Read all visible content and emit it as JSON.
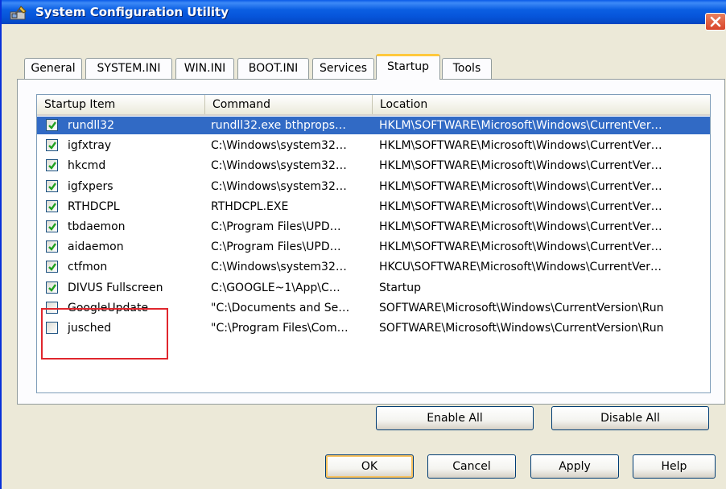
{
  "window": {
    "title": "System Configuration Utility",
    "accent": "#0654d9",
    "close_color": "#d9442a"
  },
  "tabs": [
    {
      "label": "General",
      "active": false
    },
    {
      "label": "SYSTEM.INI",
      "active": false
    },
    {
      "label": "WIN.INI",
      "active": false
    },
    {
      "label": "BOOT.INI",
      "active": false
    },
    {
      "label": "Services",
      "active": false
    },
    {
      "label": "Startup",
      "active": true
    },
    {
      "label": "Tools",
      "active": false
    }
  ],
  "list": {
    "columns": [
      "Startup Item",
      "Command",
      "Location"
    ],
    "rows": [
      {
        "checked": true,
        "selected": true,
        "item": "rundll32",
        "command": "rundll32.exe bthprops…",
        "location": "HKLM\\SOFTWARE\\Microsoft\\Windows\\CurrentVer…"
      },
      {
        "checked": true,
        "selected": false,
        "item": "igfxtray",
        "command": "C:\\Windows\\system32…",
        "location": "HKLM\\SOFTWARE\\Microsoft\\Windows\\CurrentVer…"
      },
      {
        "checked": true,
        "selected": false,
        "item": "hkcmd",
        "command": "C:\\Windows\\system32…",
        "location": "HKLM\\SOFTWARE\\Microsoft\\Windows\\CurrentVer…"
      },
      {
        "checked": true,
        "selected": false,
        "item": "igfxpers",
        "command": "C:\\Windows\\system32…",
        "location": "HKLM\\SOFTWARE\\Microsoft\\Windows\\CurrentVer…"
      },
      {
        "checked": true,
        "selected": false,
        "item": "RTHDCPL",
        "command": "RTHDCPL.EXE",
        "location": "HKLM\\SOFTWARE\\Microsoft\\Windows\\CurrentVer…"
      },
      {
        "checked": true,
        "selected": false,
        "item": "tbdaemon",
        "command": "C:\\Program Files\\UPD…",
        "location": "HKLM\\SOFTWARE\\Microsoft\\Windows\\CurrentVer…"
      },
      {
        "checked": true,
        "selected": false,
        "item": "aidaemon",
        "command": "C:\\Program Files\\UPD…",
        "location": "HKLM\\SOFTWARE\\Microsoft\\Windows\\CurrentVer…"
      },
      {
        "checked": true,
        "selected": false,
        "item": "ctfmon",
        "command": "C:\\Windows\\system32…",
        "location": "HKCU\\SOFTWARE\\Microsoft\\Windows\\CurrentVer…"
      },
      {
        "checked": true,
        "selected": false,
        "item": "DIVUS Fullscreen",
        "command": "C:\\GOOGLE~1\\App\\C…",
        "location": "Startup"
      },
      {
        "checked": false,
        "selected": false,
        "item": "GoogleUpdate",
        "command": "\"C:\\Documents and Se…",
        "location": "SOFTWARE\\Microsoft\\Windows\\CurrentVersion\\Run"
      },
      {
        "checked": false,
        "selected": false,
        "item": "jusched",
        "command": "\"C:\\Program Files\\Com…",
        "location": "SOFTWARE\\Microsoft\\Windows\\CurrentVersion\\Run"
      }
    ],
    "selected_color": "#316ac5",
    "highlight_color": "#e0262d"
  },
  "buttons": {
    "enable_all": "Enable All",
    "disable_all": "Disable All",
    "ok": "OK",
    "cancel": "Cancel",
    "apply": "Apply",
    "help": "Help"
  }
}
